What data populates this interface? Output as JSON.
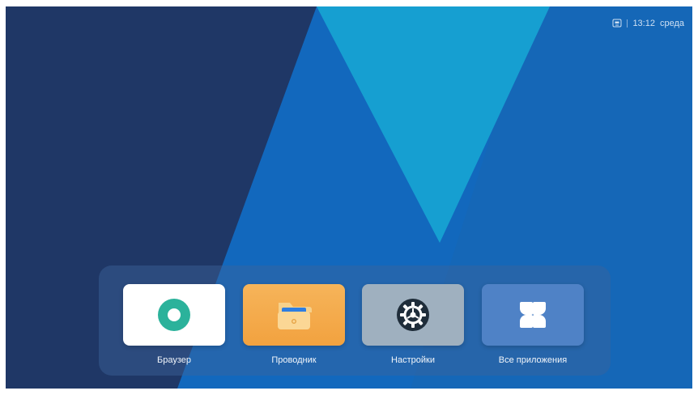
{
  "status_bar": {
    "icon": "screen-cast-icon",
    "time": "13:12",
    "day": "среда"
  },
  "dock": {
    "apps": [
      {
        "label": "Браузер",
        "icon": "browser-icon",
        "color": "#ffffff"
      },
      {
        "label": "Проводник",
        "icon": "folder-icon",
        "color": "#f4ab4a"
      },
      {
        "label": "Настройки",
        "icon": "gear-icon",
        "color": "#9fb0bf"
      },
      {
        "label": "Все приложения",
        "icon": "all-apps-icon",
        "color": "#4f82c6"
      }
    ]
  },
  "colors": {
    "background_dark": "#1e3766",
    "background_mid": "#1470c4",
    "background_light": "#1597cf"
  }
}
